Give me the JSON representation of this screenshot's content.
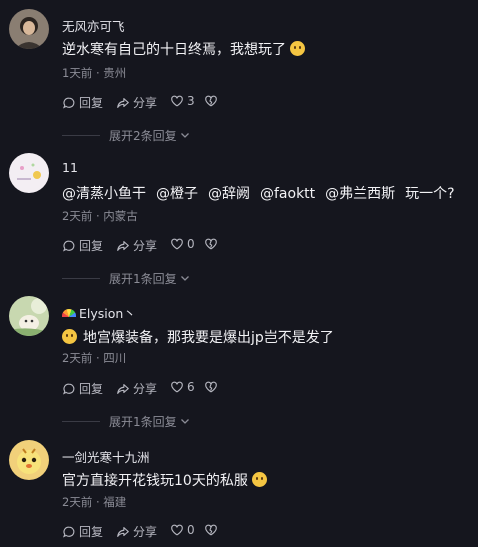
{
  "comments": [
    {
      "user": "无风亦可飞",
      "text": "逆水寒有自己的十日终焉，我想玩了",
      "time": "1天前",
      "location": "贵州",
      "reply_label": "回复",
      "share_label": "分享",
      "likes": "3",
      "expand_label": "展开2条回复"
    },
    {
      "user": "11",
      "mentions": [
        "@清蒸小鱼干",
        "@橙子",
        "@辞阙",
        "@faoktt",
        "@弗兰西斯"
      ],
      "text_suffix": "玩一个?",
      "time": "2天前",
      "location": "内蒙古",
      "reply_label": "回复",
      "share_label": "分享",
      "likes": "0",
      "expand_label": "展开1条回复"
    },
    {
      "user": "Elysion丶",
      "text": "地宫爆装备，那我要是爆出jp岂不是发了",
      "time": "2天前",
      "location": "四川",
      "reply_label": "回复",
      "share_label": "分享",
      "likes": "6",
      "expand_label": "展开1条回复"
    },
    {
      "user": "一剑光寒十九洲",
      "text": "官方直接开花钱玩10天的私服",
      "time": "2天前",
      "location": "福建",
      "reply_label": "回复",
      "share_label": "分享",
      "likes": "0"
    }
  ],
  "icons": {
    "reply": "comment-bubble-icon",
    "share": "share-arrow-icon",
    "like": "heart-icon",
    "dislike": "broken-heart-icon",
    "expand": "chevron-down-icon"
  }
}
